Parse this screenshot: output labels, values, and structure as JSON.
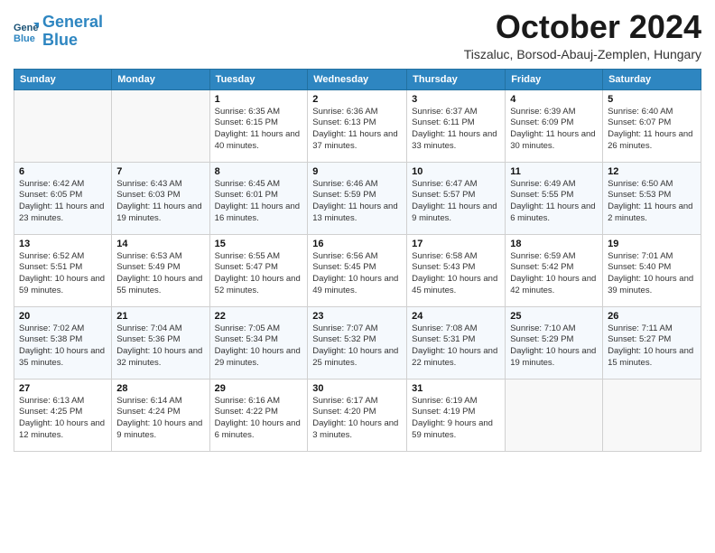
{
  "logo": {
    "line1": "General",
    "line2": "Blue"
  },
  "header": {
    "title": "October 2024",
    "subtitle": "Tiszaluc, Borsod-Abauj-Zemplen, Hungary"
  },
  "columns": [
    "Sunday",
    "Monday",
    "Tuesday",
    "Wednesday",
    "Thursday",
    "Friday",
    "Saturday"
  ],
  "weeks": [
    [
      {
        "day": "",
        "info": ""
      },
      {
        "day": "",
        "info": ""
      },
      {
        "day": "1",
        "info": "Sunrise: 6:35 AM\nSunset: 6:15 PM\nDaylight: 11 hours and 40 minutes."
      },
      {
        "day": "2",
        "info": "Sunrise: 6:36 AM\nSunset: 6:13 PM\nDaylight: 11 hours and 37 minutes."
      },
      {
        "day": "3",
        "info": "Sunrise: 6:37 AM\nSunset: 6:11 PM\nDaylight: 11 hours and 33 minutes."
      },
      {
        "day": "4",
        "info": "Sunrise: 6:39 AM\nSunset: 6:09 PM\nDaylight: 11 hours and 30 minutes."
      },
      {
        "day": "5",
        "info": "Sunrise: 6:40 AM\nSunset: 6:07 PM\nDaylight: 11 hours and 26 minutes."
      }
    ],
    [
      {
        "day": "6",
        "info": "Sunrise: 6:42 AM\nSunset: 6:05 PM\nDaylight: 11 hours and 23 minutes."
      },
      {
        "day": "7",
        "info": "Sunrise: 6:43 AM\nSunset: 6:03 PM\nDaylight: 11 hours and 19 minutes."
      },
      {
        "day": "8",
        "info": "Sunrise: 6:45 AM\nSunset: 6:01 PM\nDaylight: 11 hours and 16 minutes."
      },
      {
        "day": "9",
        "info": "Sunrise: 6:46 AM\nSunset: 5:59 PM\nDaylight: 11 hours and 13 minutes."
      },
      {
        "day": "10",
        "info": "Sunrise: 6:47 AM\nSunset: 5:57 PM\nDaylight: 11 hours and 9 minutes."
      },
      {
        "day": "11",
        "info": "Sunrise: 6:49 AM\nSunset: 5:55 PM\nDaylight: 11 hours and 6 minutes."
      },
      {
        "day": "12",
        "info": "Sunrise: 6:50 AM\nSunset: 5:53 PM\nDaylight: 11 hours and 2 minutes."
      }
    ],
    [
      {
        "day": "13",
        "info": "Sunrise: 6:52 AM\nSunset: 5:51 PM\nDaylight: 10 hours and 59 minutes."
      },
      {
        "day": "14",
        "info": "Sunrise: 6:53 AM\nSunset: 5:49 PM\nDaylight: 10 hours and 55 minutes."
      },
      {
        "day": "15",
        "info": "Sunrise: 6:55 AM\nSunset: 5:47 PM\nDaylight: 10 hours and 52 minutes."
      },
      {
        "day": "16",
        "info": "Sunrise: 6:56 AM\nSunset: 5:45 PM\nDaylight: 10 hours and 49 minutes."
      },
      {
        "day": "17",
        "info": "Sunrise: 6:58 AM\nSunset: 5:43 PM\nDaylight: 10 hours and 45 minutes."
      },
      {
        "day": "18",
        "info": "Sunrise: 6:59 AM\nSunset: 5:42 PM\nDaylight: 10 hours and 42 minutes."
      },
      {
        "day": "19",
        "info": "Sunrise: 7:01 AM\nSunset: 5:40 PM\nDaylight: 10 hours and 39 minutes."
      }
    ],
    [
      {
        "day": "20",
        "info": "Sunrise: 7:02 AM\nSunset: 5:38 PM\nDaylight: 10 hours and 35 minutes."
      },
      {
        "day": "21",
        "info": "Sunrise: 7:04 AM\nSunset: 5:36 PM\nDaylight: 10 hours and 32 minutes."
      },
      {
        "day": "22",
        "info": "Sunrise: 7:05 AM\nSunset: 5:34 PM\nDaylight: 10 hours and 29 minutes."
      },
      {
        "day": "23",
        "info": "Sunrise: 7:07 AM\nSunset: 5:32 PM\nDaylight: 10 hours and 25 minutes."
      },
      {
        "day": "24",
        "info": "Sunrise: 7:08 AM\nSunset: 5:31 PM\nDaylight: 10 hours and 22 minutes."
      },
      {
        "day": "25",
        "info": "Sunrise: 7:10 AM\nSunset: 5:29 PM\nDaylight: 10 hours and 19 minutes."
      },
      {
        "day": "26",
        "info": "Sunrise: 7:11 AM\nSunset: 5:27 PM\nDaylight: 10 hours and 15 minutes."
      }
    ],
    [
      {
        "day": "27",
        "info": "Sunrise: 6:13 AM\nSunset: 4:25 PM\nDaylight: 10 hours and 12 minutes."
      },
      {
        "day": "28",
        "info": "Sunrise: 6:14 AM\nSunset: 4:24 PM\nDaylight: 10 hours and 9 minutes."
      },
      {
        "day": "29",
        "info": "Sunrise: 6:16 AM\nSunset: 4:22 PM\nDaylight: 10 hours and 6 minutes."
      },
      {
        "day": "30",
        "info": "Sunrise: 6:17 AM\nSunset: 4:20 PM\nDaylight: 10 hours and 3 minutes."
      },
      {
        "day": "31",
        "info": "Sunrise: 6:19 AM\nSunset: 4:19 PM\nDaylight: 9 hours and 59 minutes."
      },
      {
        "day": "",
        "info": ""
      },
      {
        "day": "",
        "info": ""
      }
    ]
  ]
}
